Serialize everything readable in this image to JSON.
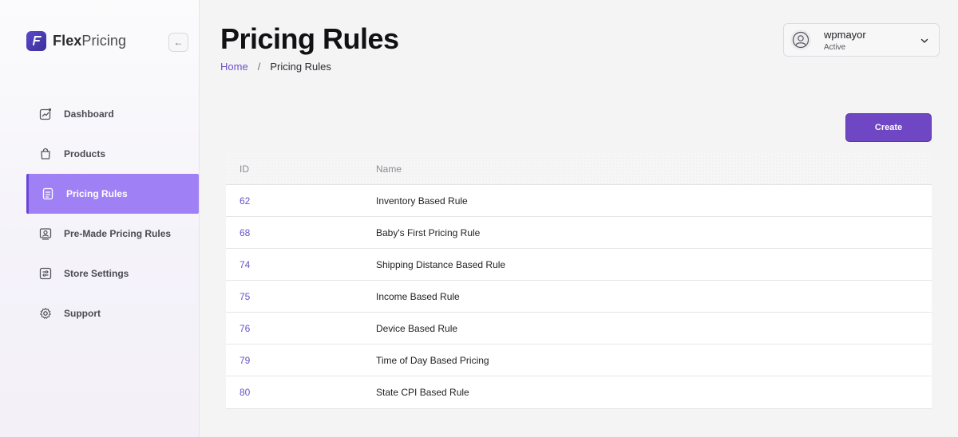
{
  "brand": {
    "name_bold": "Flex",
    "name_light": "Pricing"
  },
  "sidebar": {
    "collapse_icon": "←",
    "items": [
      {
        "label": "Dashboard",
        "icon": "chart-icon",
        "active": false
      },
      {
        "label": "Products",
        "icon": "bag-icon",
        "active": false
      },
      {
        "label": "Pricing Rules",
        "icon": "document-icon",
        "active": true
      },
      {
        "label": "Pre-Made Pricing Rules",
        "icon": "template-icon",
        "active": false
      },
      {
        "label": "Store Settings",
        "icon": "settings-sliders-icon",
        "active": false
      },
      {
        "label": "Support",
        "icon": "gear-icon",
        "active": false
      }
    ]
  },
  "header": {
    "title": "Pricing Rules",
    "breadcrumb": {
      "home": "Home",
      "separator": "/",
      "current": "Pricing Rules"
    }
  },
  "user": {
    "name": "wpmayor",
    "status": "Active"
  },
  "toolbar": {
    "create_label": "Create"
  },
  "table": {
    "columns": [
      "ID",
      "Name"
    ],
    "rows": [
      {
        "id": "62",
        "name": "Inventory Based Rule"
      },
      {
        "id": "68",
        "name": "Baby's First Pricing Rule"
      },
      {
        "id": "74",
        "name": "Shipping Distance Based Rule"
      },
      {
        "id": "75",
        "name": "Income Based Rule"
      },
      {
        "id": "76",
        "name": "Device Based Rule"
      },
      {
        "id": "79",
        "name": "Time of Day Based Pricing"
      },
      {
        "id": "80",
        "name": "State CPI Based Rule"
      }
    ]
  },
  "colors": {
    "accent": "#6f47c4",
    "active_nav": "#a081f5",
    "link": "#6b52c9"
  }
}
